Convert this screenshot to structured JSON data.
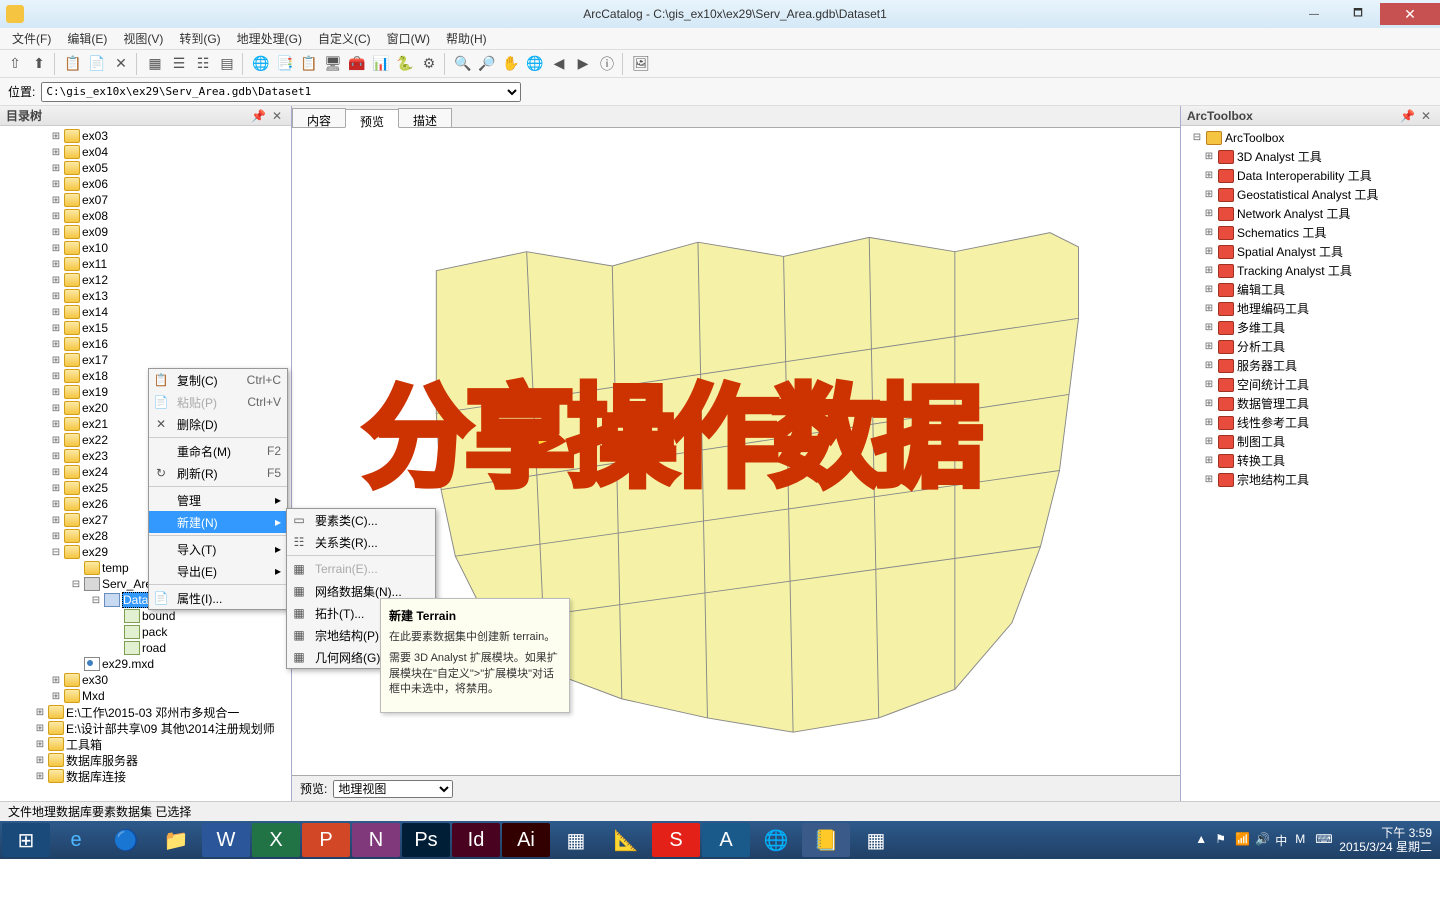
{
  "window": {
    "title": "ArcCatalog - C:\\gis_ex10x\\ex29\\Serv_Area.gdb\\Dataset1"
  },
  "menus": [
    "文件(F)",
    "编辑(E)",
    "视图(V)",
    "转到(G)",
    "地理处理(G)",
    "自定义(C)",
    "窗口(W)",
    "帮助(H)"
  ],
  "location": {
    "label": "位置:",
    "path": "C:\\gis_ex10x\\ex29\\Serv_Area.gdb\\Dataset1"
  },
  "treePanel": {
    "title": "目录树"
  },
  "tree": {
    "folders": [
      "ex03",
      "ex04",
      "ex05",
      "ex06",
      "ex07",
      "ex08",
      "ex09",
      "ex10",
      "ex11",
      "ex12",
      "ex13",
      "ex14",
      "ex15",
      "ex16",
      "ex17",
      "ex18",
      "ex19",
      "ex20",
      "ex21",
      "ex22",
      "ex23",
      "ex24",
      "ex25",
      "ex26",
      "ex27",
      "ex28"
    ],
    "ex29": {
      "name": "ex29",
      "temp": "temp",
      "gdb": "Serv_Are",
      "dataset": "Dataset1",
      "bound": "bound",
      "pack": "pack",
      "road": "road",
      "mxd": "ex29.mxd"
    },
    "ex30": "ex30",
    "mxd_folder": "Mxd",
    "drive1": "E:\\工作\\2015-03 邓州市多规合一",
    "drive2": "E:\\设计部共享\\09 其他\\2014注册规划师",
    "toolbox": "工具箱",
    "dbserver": "数据库服务器",
    "dbconn": "数据库连接"
  },
  "tabs": {
    "content": "内容",
    "preview": "预览",
    "desc": "描述"
  },
  "previewBar": {
    "label": "预览:",
    "value": "地理视图"
  },
  "context1": [
    {
      "icon": "📋",
      "label": "复制(C)",
      "hotkey": "Ctrl+C"
    },
    {
      "icon": "📄",
      "label": "粘贴(P)",
      "hotkey": "Ctrl+V",
      "disabled": true
    },
    {
      "icon": "✕",
      "label": "删除(D)"
    },
    {
      "sep": true
    },
    {
      "icon": "",
      "label": "重命名(M)",
      "hotkey": "F2"
    },
    {
      "icon": "↻",
      "label": "刷新(R)",
      "hotkey": "F5"
    },
    {
      "sep": true
    },
    {
      "label": "管理",
      "sub": true
    },
    {
      "label": "新建(N)",
      "sub": true,
      "highlight": true
    },
    {
      "sep": true
    },
    {
      "label": "导入(T)",
      "sub": true
    },
    {
      "label": "导出(E)",
      "sub": true
    },
    {
      "sep": true
    },
    {
      "icon": "📄",
      "label": "属性(I)..."
    }
  ],
  "context2": [
    {
      "icon": "▭",
      "label": "要素类(C)..."
    },
    {
      "icon": "☷",
      "label": "关系类(R)..."
    },
    {
      "sep": true
    },
    {
      "icon": "▦",
      "label": "Terrain(E)...",
      "disabled": true
    },
    {
      "icon": "▦",
      "label": "网络数据集(N)..."
    },
    {
      "icon": "▦",
      "label": "拓扑(T)..."
    },
    {
      "icon": "▦",
      "label": "宗地结构(P)..."
    },
    {
      "icon": "▦",
      "label": "几何网络(G)..."
    }
  ],
  "tooltip": {
    "title": "新建 Terrain",
    "body1": "在此要素数据集中创建新 terrain。",
    "body2": "需要 3D Analyst 扩展模块。如果扩展模块在\"自定义\">\"扩展模块\"对话框中未选中，将禁用。"
  },
  "toolbox": {
    "title": "ArcToolbox",
    "root": "ArcToolbox",
    "items": [
      "3D Analyst 工具",
      "Data Interoperability 工具",
      "Geostatistical Analyst 工具",
      "Network Analyst 工具",
      "Schematics 工具",
      "Spatial Analyst 工具",
      "Tracking Analyst 工具",
      "编辑工具",
      "地理编码工具",
      "多维工具",
      "分析工具",
      "服务器工具",
      "空间统计工具",
      "数据管理工具",
      "线性参考工具",
      "制图工具",
      "转换工具",
      "宗地结构工具"
    ]
  },
  "status": "文件地理数据库要素数据集 已选择",
  "taskbar": {
    "time": "下午 3:59",
    "date": "2015/3/24 星期二"
  },
  "overlay": "分享操作数据"
}
